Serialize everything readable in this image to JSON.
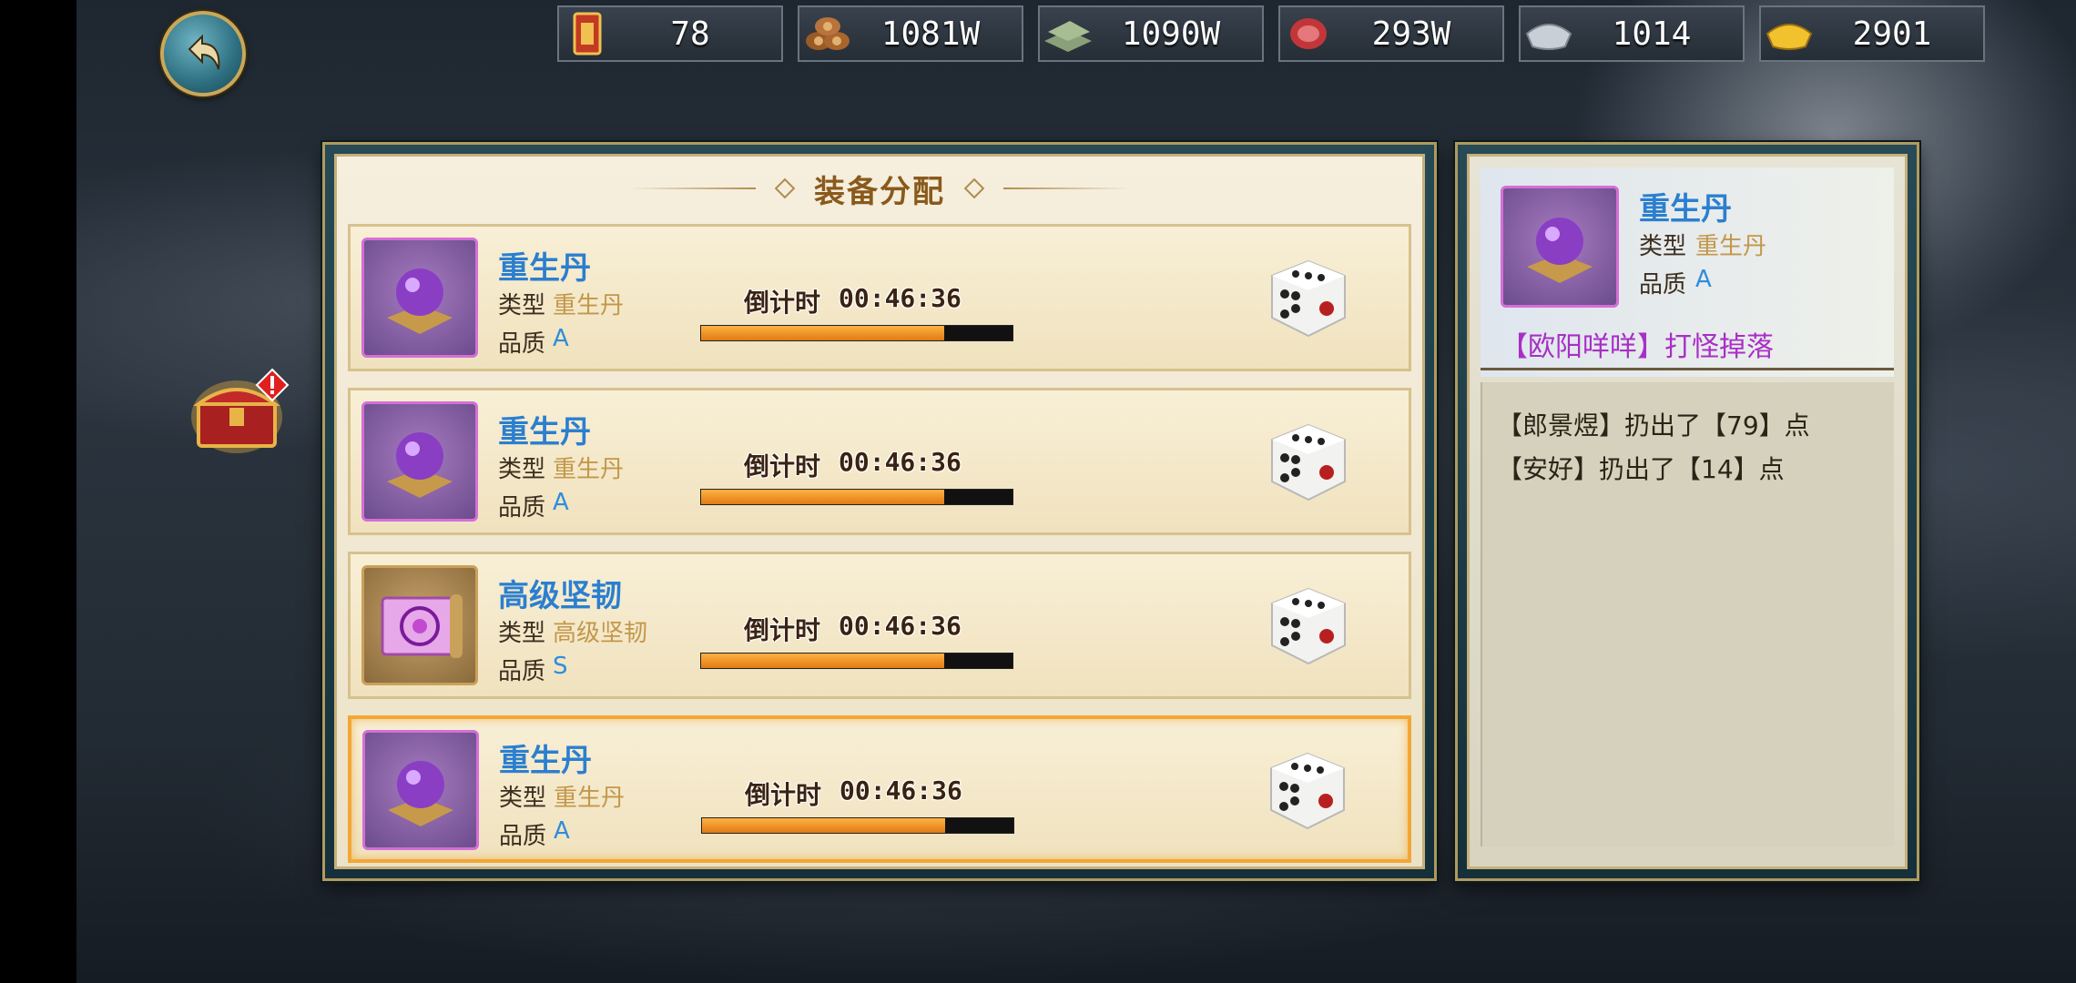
{
  "resources": [
    {
      "name": "order-token",
      "icon": "token-icon",
      "value": "78"
    },
    {
      "name": "wood",
      "icon": "wood-icon",
      "value": "1081W"
    },
    {
      "name": "stone",
      "icon": "stone-icon",
      "value": "1090W"
    },
    {
      "name": "meat",
      "icon": "meat-icon",
      "value": "293W"
    },
    {
      "name": "silver",
      "icon": "silver-icon",
      "value": "1014"
    },
    {
      "name": "gold",
      "icon": "gold-icon",
      "value": "2901"
    }
  ],
  "panel": {
    "title": "装备分配"
  },
  "labels": {
    "type": "类型",
    "quality": "品质",
    "countdown": "倒计时"
  },
  "items": [
    {
      "name": "重生丹",
      "type": "重生丹",
      "quality": "A",
      "countdown": "00:46:36",
      "progress": 0.78,
      "icon": "purple-orb-icon",
      "selected": false
    },
    {
      "name": "重生丹",
      "type": "重生丹",
      "quality": "A",
      "countdown": "00:46:36",
      "progress": 0.78,
      "icon": "purple-orb-icon",
      "selected": false
    },
    {
      "name": "高级坚韧",
      "type": "高级坚韧",
      "quality": "S",
      "countdown": "00:46:36",
      "progress": 0.78,
      "icon": "scroll-icon",
      "selected": false
    },
    {
      "name": "重生丹",
      "type": "重生丹",
      "quality": "A",
      "countdown": "00:46:36",
      "progress": 0.78,
      "icon": "purple-orb-icon",
      "selected": true
    }
  ],
  "detail": {
    "name": "重生丹",
    "type_label": "类型",
    "type": "重生丹",
    "quality_label": "品质",
    "quality": "A",
    "source": "【欧阳咩咩】打怪掉落",
    "log": [
      "【郎景煜】扔出了【79】点",
      "【安好】扔出了【14】点"
    ]
  },
  "colors": {
    "name_blue": "#2b7fcf",
    "type_gold": "#c3974a",
    "quality_blue": "#2f8ddc",
    "source_purple": "#a82fc6",
    "title_brown": "#8a5a1c",
    "progress_orange": "#f29a2a"
  }
}
